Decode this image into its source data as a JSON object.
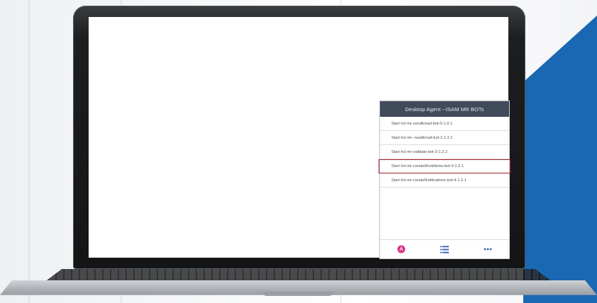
{
  "colors": {
    "accent_blue": "#1a67b3",
    "panel_header": "#3f4a5a",
    "selection_border": "#a2202a",
    "logo_pink": "#d63384"
  },
  "panel": {
    "title": "Desktop Agent --ISAM MR BOTs",
    "items": [
      {
        "label": "Start hcl-mr-sendEmail-bot-0-1.0.1",
        "selected": false
      },
      {
        "label": "Start hcl-mr- readEmail-bot-1-1.2.1",
        "selected": false
      },
      {
        "label": "Start hcl-mr-validate-bot-2-1.2.2",
        "selected": false
      },
      {
        "label": "Start hcl-mr-createWorkItems-bot-3-1.2.1",
        "selected": true
      },
      {
        "label": "Start hcl-mr-createNotifications-bot-4-1.2.1",
        "selected": false
      }
    ],
    "footer_icons": [
      "agent-logo-icon",
      "list-icon",
      "more-icon"
    ]
  }
}
